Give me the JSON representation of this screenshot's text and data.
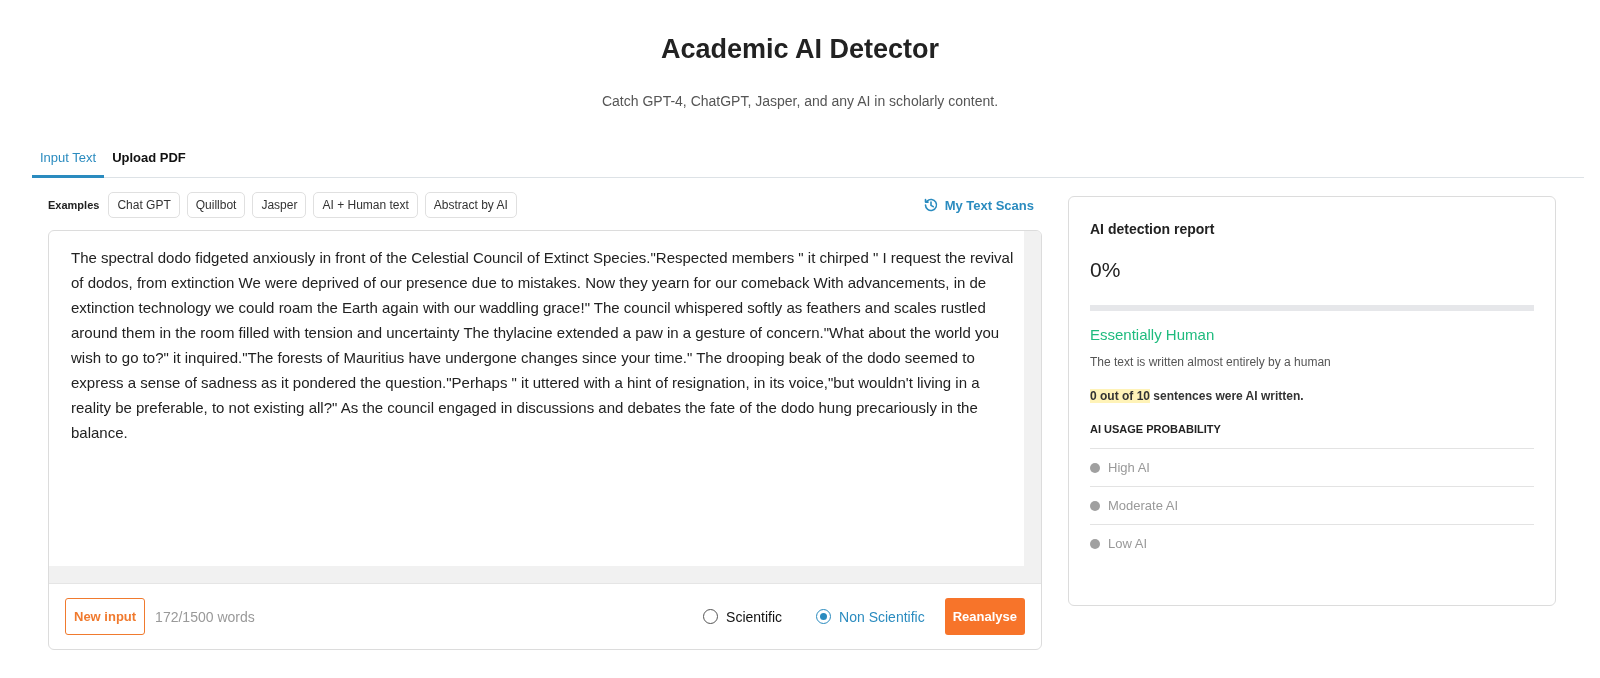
{
  "header": {
    "title": "Academic AI Detector",
    "subtitle": "Catch GPT-4, ChatGPT, Jasper, and any AI in scholarly content."
  },
  "tabs": [
    {
      "label": "Input Text",
      "selected": true
    },
    {
      "label": "Upload PDF",
      "selected": false
    }
  ],
  "examples": {
    "label": "Examples",
    "items": [
      "Chat GPT",
      "Quillbot",
      "Jasper",
      "AI + Human text",
      "Abstract by AI"
    ]
  },
  "history_link": "My Text Scans",
  "editor": {
    "value": "The spectral dodo fidgeted anxiously in front of the Celestial Council of Extinct Species.\"Respected members \" it chirped \" I request the revival of dodos, from extinction We were deprived of our presence due to mistakes. Now they yearn for our comeback With advancements, in de extinction technology we could roam the Earth again with our waddling grace!\" The council whispered softly as feathers and scales rustled around them in the room filled with tension and uncertainty The thylacine extended a paw in a gesture of concern.\"What about the world you wish to go to?\" it inquired.\"The forests of Mauritius have undergone changes since your time.\" The drooping beak of the dodo seemed to express a sense of sadness as it pondered the question.\"Perhaps \" it uttered with a hint of resignation, in its voice,\"but wouldn't living in a reality be preferable, to not existing all?\" As the council engaged in discussions and debates the fate of the dodo hung precariously in the balance."
  },
  "footer": {
    "new_input": "New input",
    "word_count": "172/1500 words",
    "modes": [
      {
        "label": "Scientific",
        "selected": false
      },
      {
        "label": "Non Scientific",
        "selected": true
      }
    ],
    "submit": "Reanalyse"
  },
  "report": {
    "title": "AI detection report",
    "percent": "0%",
    "level": 0,
    "verdict": "Essentially Human",
    "description": "The text is written almost entirely by a human",
    "sentences_highlight": "0 out of 10",
    "sentences_rest": "sentences were AI written.",
    "probability_heading": "AI USAGE PROBABILITY",
    "legend": [
      {
        "label": "High AI"
      },
      {
        "label": "Moderate AI"
      },
      {
        "label": "Low AI"
      }
    ]
  }
}
